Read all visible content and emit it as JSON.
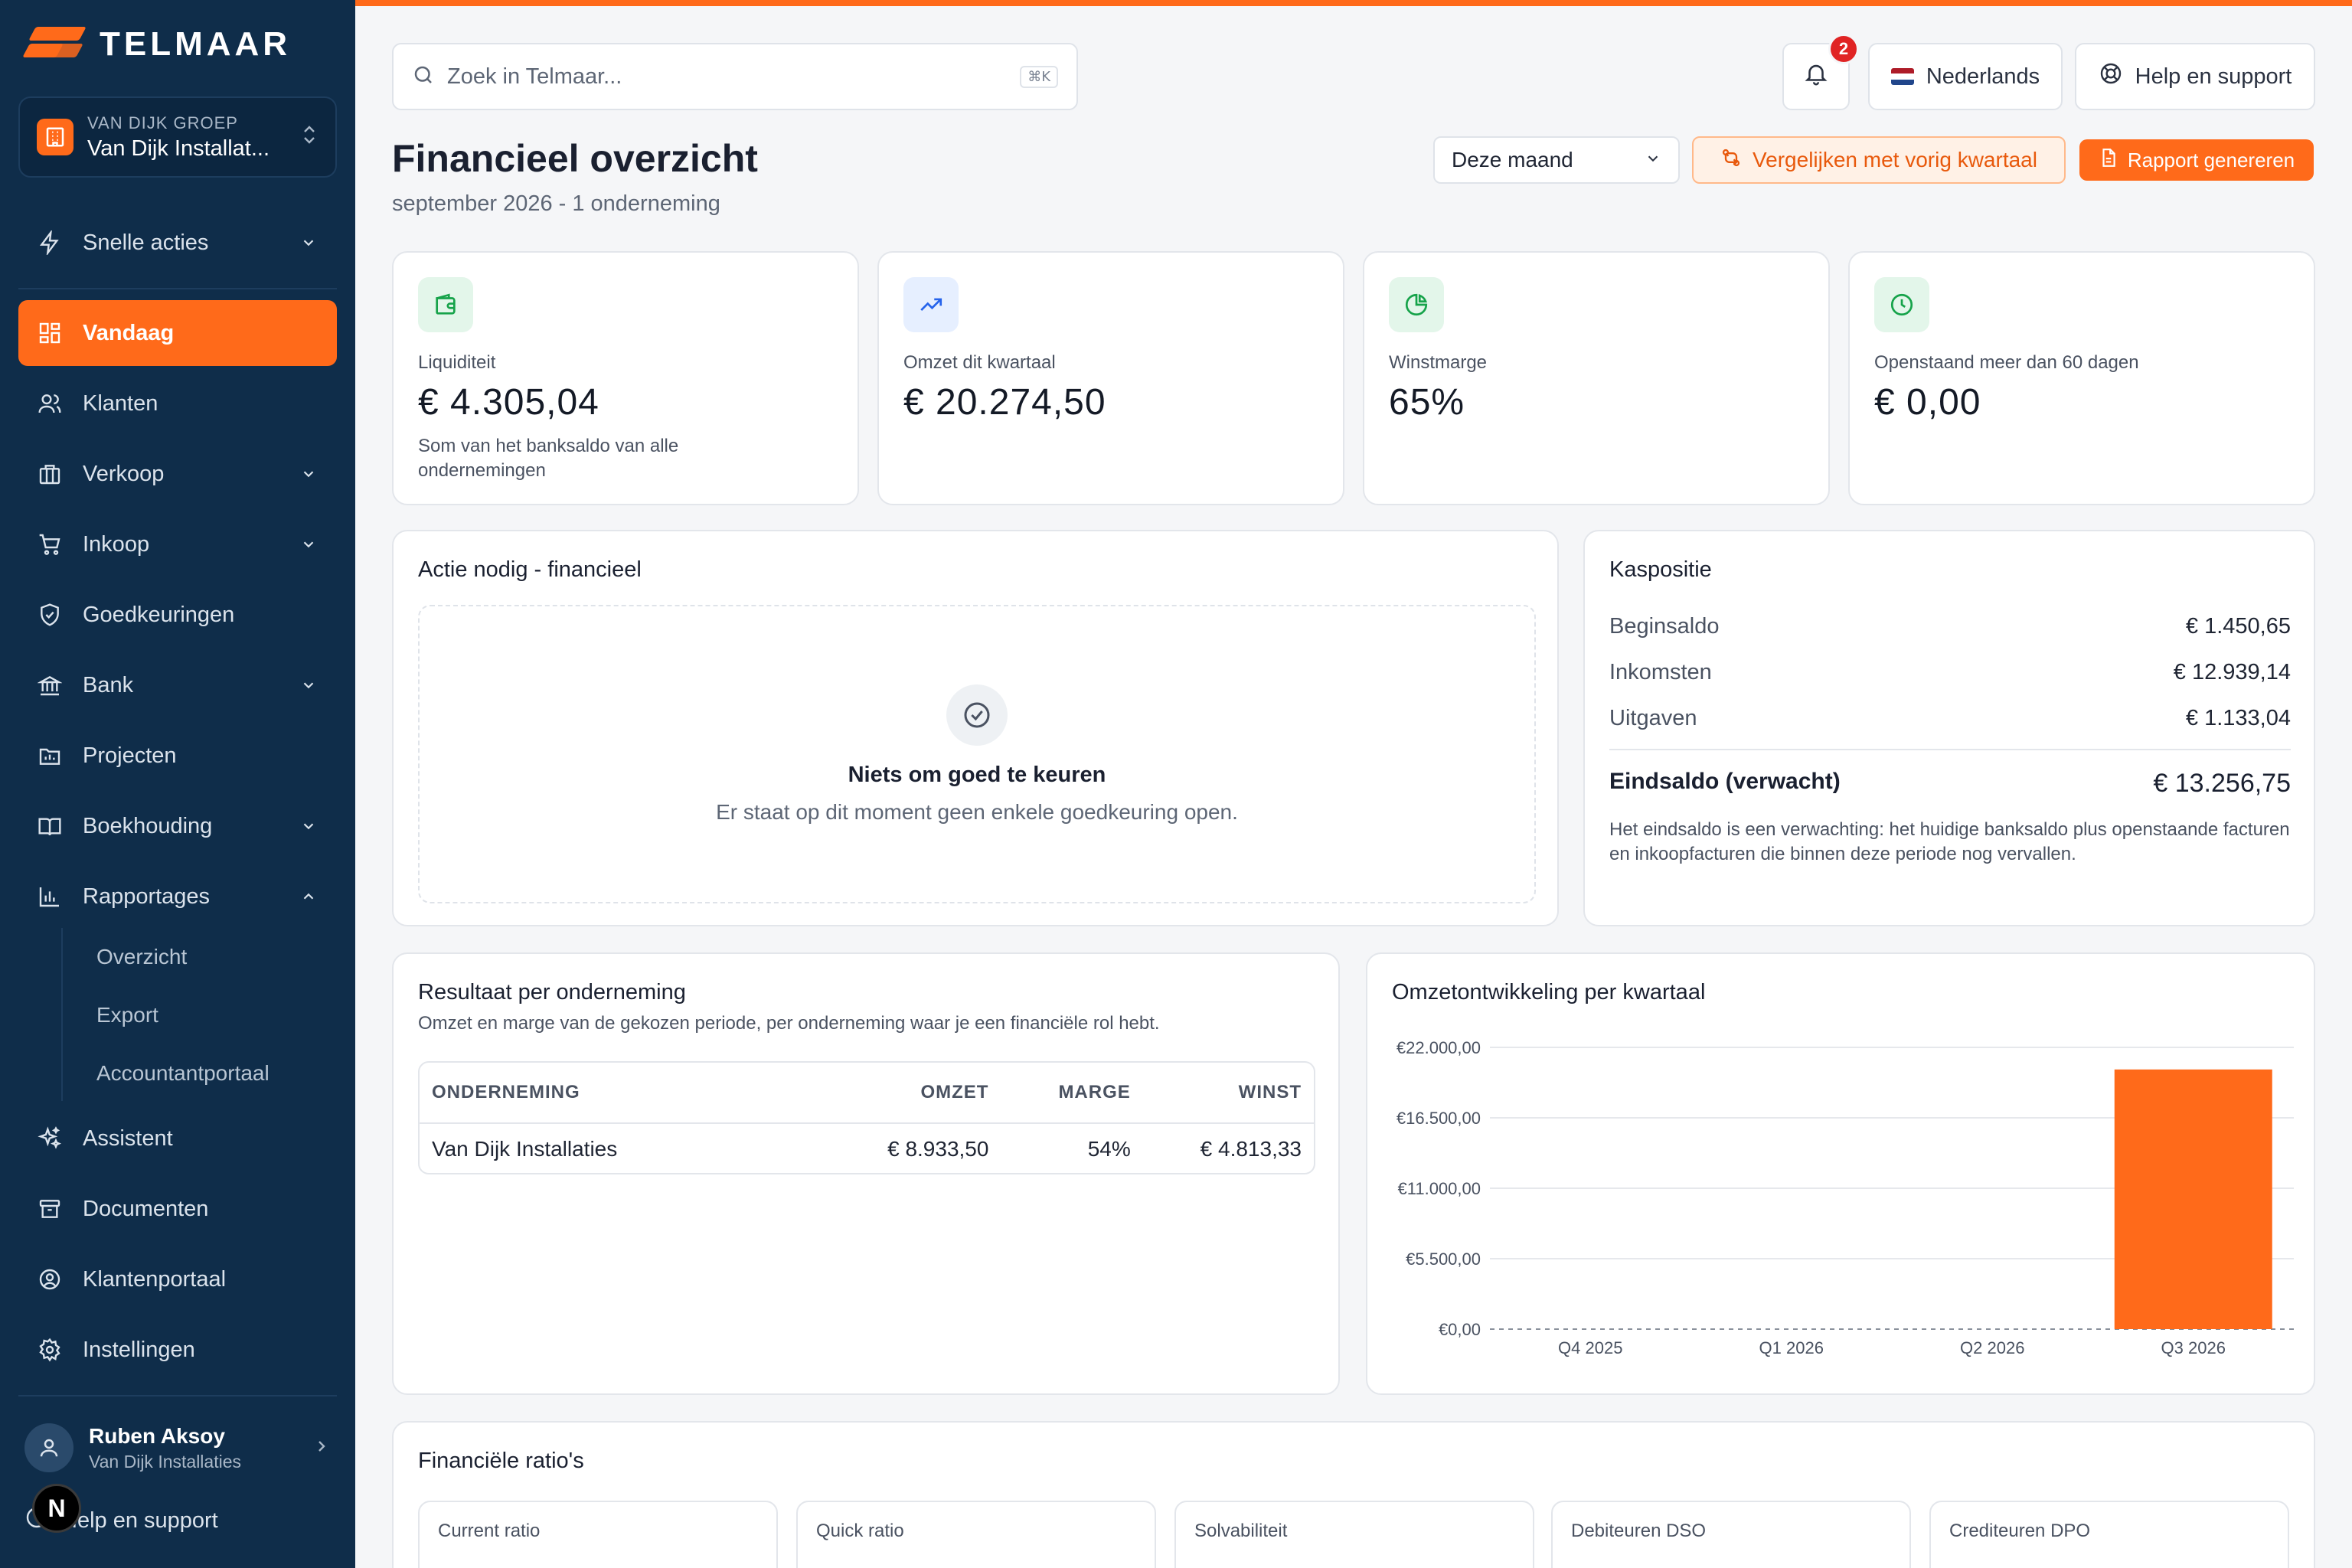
{
  "brand": {
    "name": "TELMAAR",
    "accent": "#ff6a1a",
    "sidebar_bg": "#0f2d4a"
  },
  "org": {
    "group": "VAN DIJK GROEP",
    "name": "Van Dijk Installat..."
  },
  "nav": {
    "snelle_acties": "Snelle acties",
    "vandaag": "Vandaag",
    "klanten": "Klanten",
    "verkoop": "Verkoop",
    "inkoop": "Inkoop",
    "goedkeuringen": "Goedkeuringen",
    "bank": "Bank",
    "projecten": "Projecten",
    "boekhouding": "Boekhouding",
    "rapportages": "Rapportages",
    "sub": {
      "overzicht": "Overzicht",
      "export": "Export",
      "accountantportaal": "Accountantportaal"
    },
    "assistent": "Assistent",
    "documenten": "Documenten",
    "klantenportaal": "Klantenportaal",
    "instellingen": "Instellingen"
  },
  "user": {
    "name": "Ruben Aksoy",
    "org": "Van Dijk Installaties",
    "help": "Help en support",
    "badge": "N"
  },
  "header": {
    "search_placeholder": "Zoek in Telmaar...",
    "search_shortcut": "⌘K",
    "notifications_count": "2",
    "language": "Nederlands",
    "help": "Help en support"
  },
  "page": {
    "title": "Financieel overzicht",
    "subtitle": "september 2026 - 1 onderneming",
    "period_select": "Deze maand",
    "compare_button": "Vergelijken met vorig kwartaal",
    "report_button": "Rapport genereren"
  },
  "kpis": [
    {
      "label": "Liquiditeit",
      "value": "€ 4.305,04",
      "desc": "Som van het banksaldo van alle ondernemingen",
      "icon": "wallet-icon"
    },
    {
      "label": "Omzet dit kwartaal",
      "value": "€ 20.274,50",
      "desc": "",
      "icon": "trending-up-icon"
    },
    {
      "label": "Winstmarge",
      "value": "65%",
      "desc": "",
      "icon": "pie-chart-icon"
    },
    {
      "label": "Openstaand meer dan 60 dagen",
      "value": "€ 0,00",
      "desc": "",
      "icon": "clock-icon"
    }
  ],
  "actie": {
    "title": "Actie nodig - financieel",
    "empty_title": "Niets om goed te keuren",
    "empty_desc": "Er staat op dit moment geen enkele goedkeuring open."
  },
  "kaspositie": {
    "title": "Kaspositie",
    "rows": [
      {
        "label": "Beginsaldo",
        "value": "€ 1.450,65"
      },
      {
        "label": "Inkomsten",
        "value": "€ 12.939,14"
      },
      {
        "label": "Uitgaven",
        "value": "€ 1.133,04"
      }
    ],
    "total_label": "Eindsaldo (verwacht)",
    "total_value": "€ 13.256,75",
    "note": "Het eindsaldo is een verwachting: het huidige banksaldo plus openstaande facturen en inkoopfacturen die binnen deze periode nog vervallen."
  },
  "resultaat": {
    "title": "Resultaat per onderneming",
    "subtitle": "Omzet en marge van de gekozen periode, per onderneming waar je een financiële rol hebt.",
    "headers": {
      "onderneming": "ONDERNEMING",
      "omzet": "OMZET",
      "marge": "MARGE",
      "winst": "WINST"
    },
    "rows": [
      {
        "onderneming": "Van Dijk Installaties",
        "omzet": "€ 8.933,50",
        "marge": "54%",
        "winst": "€ 4.813,33"
      }
    ]
  },
  "omzet_chart_title": "Omzetontwikkeling per kwartaal",
  "chart_data": {
    "type": "bar",
    "title": "Omzetontwikkeling per kwartaal",
    "categories": [
      "Q4 2025",
      "Q1 2026",
      "Q2 2026",
      "Q3 2026"
    ],
    "values": [
      0,
      0,
      0,
      20274.5
    ],
    "y_ticks": [
      "€0,00",
      "€5.500,00",
      "€11.000,00",
      "€16.500,00",
      "€22.000,00"
    ],
    "ylim": [
      0,
      22000
    ],
    "bar_color": "#ff6a1a",
    "grid": true
  },
  "ratios": {
    "title": "Financiële ratio's",
    "items": [
      {
        "label": "Current ratio"
      },
      {
        "label": "Quick ratio"
      },
      {
        "label": "Solvabiliteit"
      },
      {
        "label": "Debiteuren DSO"
      },
      {
        "label": "Crediteuren DPO"
      }
    ]
  }
}
